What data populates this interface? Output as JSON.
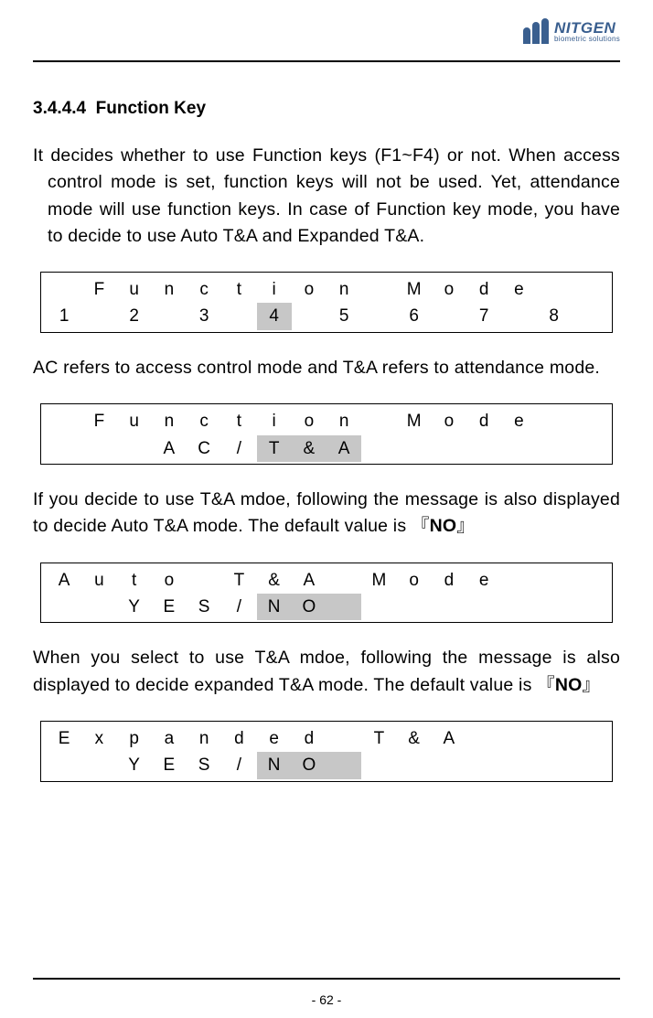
{
  "logo": {
    "name": "NITGEN",
    "sub": "biometric solutions"
  },
  "section": {
    "number": "3.4.4.4",
    "title": "Function Key"
  },
  "para1": "It decides whether to use Function keys (F1~F4) or not. When access control mode is set, function keys will not be used. Yet, attendance mode will use function keys. In case of Function key mode, you have to decide to use Auto T&A and Expanded T&A.",
  "lcd1": {
    "row1": [
      "",
      "F",
      "u",
      "n",
      "c",
      "t",
      "i",
      "o",
      "n",
      "",
      "M",
      "o",
      "d",
      "e",
      "",
      ""
    ],
    "row2": [
      "1",
      "",
      "2",
      "",
      "3",
      "",
      "4",
      "",
      "5",
      "",
      "6",
      "",
      "7",
      "",
      "8",
      ""
    ],
    "hl2": [
      6
    ]
  },
  "para2": "AC refers to access control mode and T&A refers to attendance mode.",
  "lcd2": {
    "row1": [
      "",
      "F",
      "u",
      "n",
      "c",
      "t",
      "i",
      "o",
      "n",
      "",
      "M",
      "o",
      "d",
      "e",
      "",
      ""
    ],
    "row2": [
      "",
      "",
      "",
      "A",
      "C",
      "/",
      "T",
      "&",
      "A",
      "",
      "",
      "",
      "",
      "",
      "",
      ""
    ],
    "hl2": [
      6,
      7,
      8
    ]
  },
  "para3_pre": "If you decide to use T&A mdoe, following the message is also displayed to decide Auto T&A mode. The default value is 『",
  "para3_bold": "NO",
  "para3_post": "』",
  "lcd3": {
    "row1": [
      "A",
      "u",
      "t",
      "o",
      "",
      "T",
      "&",
      "A",
      "",
      "M",
      "o",
      "d",
      "e",
      "",
      "",
      ""
    ],
    "row2": [
      "",
      "",
      "Y",
      "E",
      "S",
      "/",
      "N",
      "O",
      "",
      "",
      "",
      "",
      "",
      "",
      "",
      ""
    ],
    "hl2": [
      6,
      7,
      8
    ]
  },
  "para4_pre": "When you select to use T&A mdoe, following the message is also displayed to decide expanded T&A mode. The default value is 『",
  "para4_bold": "NO",
  "para4_post": "』",
  "lcd4": {
    "row1": [
      "E",
      "x",
      "p",
      "a",
      "n",
      "d",
      "e",
      "d",
      "",
      "T",
      "&",
      "A",
      "",
      "",
      "",
      ""
    ],
    "row2": [
      "",
      "",
      "Y",
      "E",
      "S",
      "/",
      "N",
      "O",
      "",
      "",
      "",
      "",
      "",
      "",
      "",
      ""
    ],
    "hl2": [
      6,
      7,
      8
    ]
  },
  "page_num": "- 62 -"
}
